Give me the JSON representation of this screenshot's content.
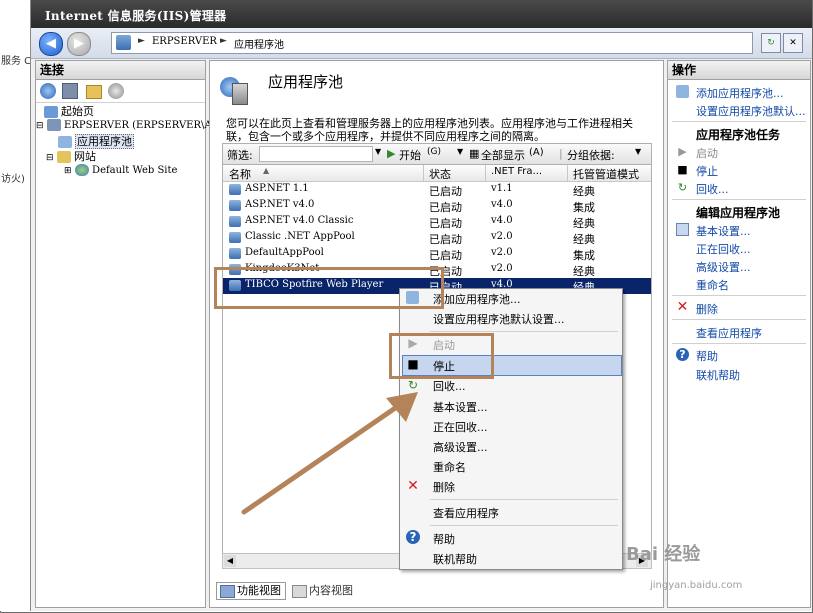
{
  "window_title": "Internet 信息服务(IIS)管理器",
  "left_strip": {
    "t1": "服务 C",
    "t2": "访火) "
  },
  "address": {
    "server": "ERPSERVER",
    "page": "应用程序池"
  },
  "connections": {
    "header": "连接",
    "tree": [
      {
        "label": "起始页"
      },
      {
        "label": "ERPSERVER (ERPSERVER\\Ad"
      },
      {
        "label": "应用程序池"
      },
      {
        "label": "网站"
      },
      {
        "label": "Default Web Site"
      }
    ]
  },
  "main": {
    "title": "应用程序池",
    "description": "您可以在此页上查看和管理服务器上的应用程序池列表。应用程序池与工作进程相关联，包含一个或多个应用程序，并提供不同应用程序之间的隔离。",
    "filter": {
      "label": "筛选:",
      "start": "开始",
      "start_key": "(G)",
      "show_all": "全部显示",
      "show_all_key": "(A)",
      "group_by": "分组依据:"
    },
    "columns": {
      "name": "名称",
      "status": "状态",
      "net": ".NET Fra...",
      "pipeline": "托管管道模式"
    },
    "rows": [
      {
        "name": "ASP.NET 1.1",
        "status": "已启动",
        "net": "v1.1",
        "pipeline": "经典"
      },
      {
        "name": "ASP.NET v4.0",
        "status": "已启动",
        "net": "v4.0",
        "pipeline": "集成"
      },
      {
        "name": "ASP.NET v4.0 Classic",
        "status": "已启动",
        "net": "v4.0",
        "pipeline": "经典"
      },
      {
        "name": "Classic .NET AppPool",
        "status": "已启动",
        "net": "v2.0",
        "pipeline": "经典"
      },
      {
        "name": "DefaultAppPool",
        "status": "已启动",
        "net": "v2.0",
        "pipeline": "集成"
      },
      {
        "name": "KingdeeK3Net",
        "status": "已启动",
        "net": "v2.0",
        "pipeline": "经典"
      },
      {
        "name": "TIBCO Spotfire Web Player",
        "status": "已启动",
        "net": "v4.0",
        "pipeline": "经典"
      }
    ],
    "view_tabs": {
      "features": "功能视图",
      "content": "内容视图"
    }
  },
  "actions": {
    "header": "操作",
    "add_pool": "添加应用程序池...",
    "set_defaults": "设置应用程序池默认...",
    "tasks_header": "应用程序池任务",
    "start": "启动",
    "stop": "停止",
    "recycle": "回收...",
    "edit_header": "编辑应用程序池",
    "basic": "基本设置...",
    "recycling": "正在回收...",
    "advanced": "高级设置...",
    "rename": "重命名",
    "delete": "删除",
    "view_apps": "查看应用程序",
    "help": "帮助",
    "online_help": "联机帮助"
  },
  "context_menu": {
    "add_pool": "添加应用程序池...",
    "set_defaults": "设置应用程序池默认设置...",
    "start": "启动",
    "stop": "停止",
    "recycle": "回收...",
    "basic": "基本设置...",
    "recycling": "正在回收...",
    "advanced": "高级设置...",
    "rename": "重命名",
    "delete": "删除",
    "view_apps": "查看应用程序",
    "help": "帮助",
    "online_help": "联机帮助"
  },
  "watermark": {
    "brand": "Bai 经验",
    "url": "jingyan.baidu.com"
  },
  "colors": {
    "accent": "#1148a8",
    "selection": "#0a246a",
    "annotation": "#b5835a"
  }
}
